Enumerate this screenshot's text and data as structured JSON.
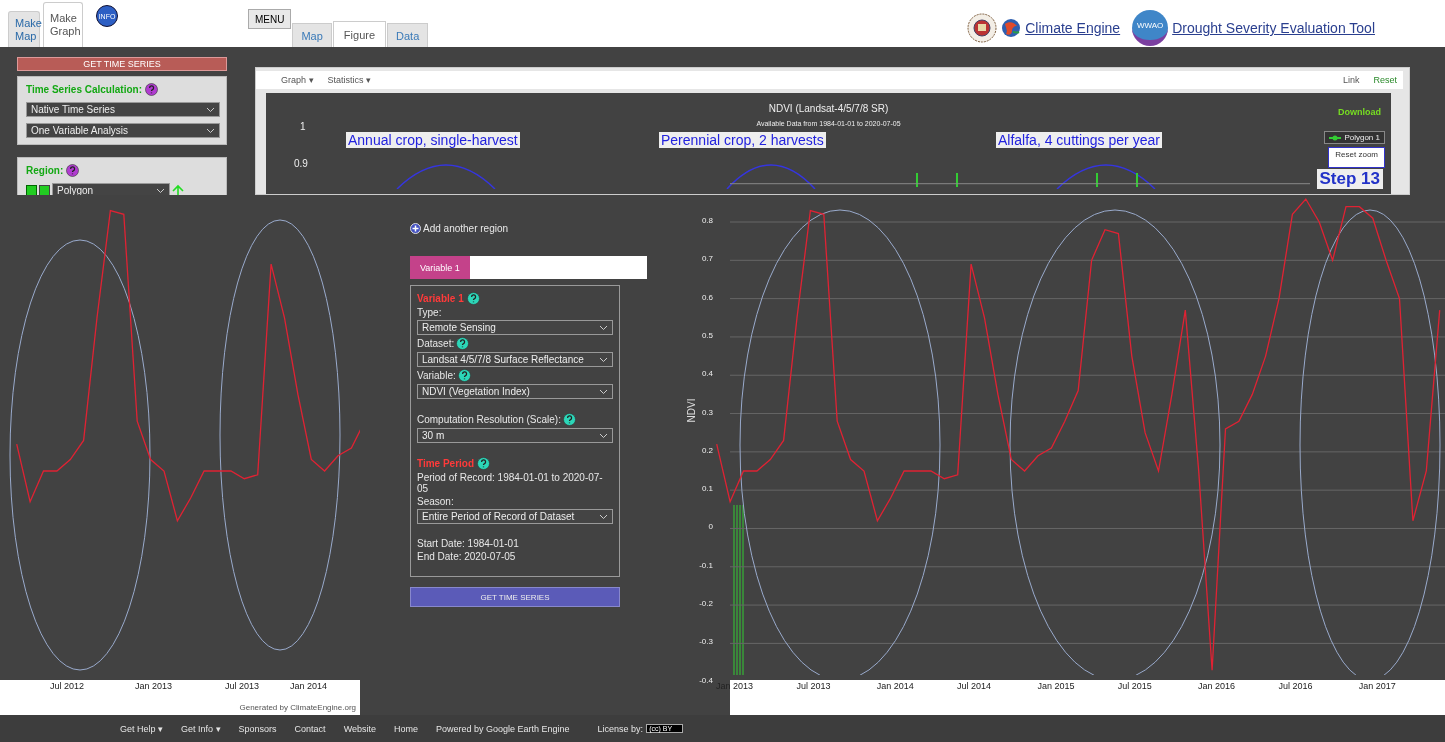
{
  "nav_tabs": [
    {
      "label": "Make Map",
      "selected": false
    },
    {
      "label": "Make Graph",
      "selected": true
    }
  ],
  "info_badge": "INFO",
  "menu_button": "MENU",
  "view_tabs": [
    {
      "label": "Map",
      "selected": false
    },
    {
      "label": "Figure",
      "selected": true
    },
    {
      "label": "Data",
      "selected": false
    }
  ],
  "header": {
    "title": "Climate Engine",
    "badge": "WWAO",
    "subtitle": "Drought Severity Evaluation Tool"
  },
  "sidebar": {
    "button": "GET TIME SERIES",
    "calc_label": "Time Series Calculation:",
    "calc_selects": [
      "Native Time Series",
      "One Variable Analysis"
    ],
    "region_label": "Region:",
    "region_checked": true,
    "region_select": "Polygon"
  },
  "chart_toolbar": {
    "menus": [
      "Graph ▾",
      "Statistics ▾"
    ],
    "links": [
      "Link",
      "Reset"
    ]
  },
  "chart": {
    "title": "NDVI (Landsat-4/5/7/8 SR)",
    "subtitle": "Available Data from 1984-01-01 to 2020-07-05",
    "download": "Download",
    "reset_zoom": "Reset zoom",
    "top_yticks": [
      "1",
      "0.9"
    ],
    "annotations": [
      "Annual crop, single-harvest",
      "Perennial crop, 2 harvests",
      "Alfalfa, 4 cuttings per year"
    ],
    "step": "Step 13",
    "left_xticks": [
      "Jul 2012",
      "Jan 2013",
      "Jul 2013",
      "Jan 2014"
    ],
    "credit": "Generated by ClimateEngine.org",
    "chart_data": {
      "type": "line",
      "ylabel": "NDVI",
      "categories": [
        null,
        "Jan 2013",
        null,
        null,
        null,
        null,
        null,
        "Jul 2013",
        null,
        null,
        null,
        null,
        null,
        "Jan 2014",
        null,
        null,
        null,
        null,
        null,
        "Jul 2014",
        null,
        null,
        null,
        null,
        null,
        "Jan 2015",
        null,
        null,
        null,
        null,
        null,
        "Jul 2015",
        null,
        null,
        null,
        null,
        null,
        "Jan 2016",
        null,
        null,
        null,
        null,
        null,
        "Jul 2016",
        null,
        null,
        null,
        null,
        null,
        "Jan 2017",
        null,
        null,
        null,
        null,
        null
      ],
      "series": [
        {
          "name": "Polygon 1",
          "color": "#e02233",
          "values": [
            0.22,
            0.07,
            0.15,
            0.15,
            0.18,
            0.23,
            0.55,
            0.83,
            0.82,
            0.28,
            0.18,
            0.15,
            0.02,
            0.08,
            0.15,
            0.15,
            0.15,
            0.13,
            0.14,
            0.69,
            0.55,
            0.35,
            0.18,
            0.15,
            0.19,
            0.21,
            0.28,
            0.36,
            0.7,
            0.78,
            0.77,
            0.45,
            0.25,
            0.15,
            0.35,
            0.57,
            0.15,
            -0.37,
            0.26,
            0.28,
            0.35,
            0.45,
            0.6,
            0.82,
            0.86,
            0.8,
            0.7,
            0.84,
            0.84,
            0.81,
            0.7,
            0.6,
            0.02,
            0.15,
            0.57
          ]
        }
      ],
      "ylim": [
        -0.4,
        0.9
      ],
      "grid": true,
      "yticks": [
        0.8,
        0.7,
        0.6,
        0.5,
        0.4,
        0.3,
        0.2,
        0.1,
        0,
        -0.1,
        -0.2,
        -0.3,
        -0.4
      ]
    }
  },
  "variable_panel": {
    "add_region": "Add another region",
    "tab": "Variable 1",
    "heading": "Variable 1",
    "type_label": "Type:",
    "type_value": "Remote Sensing",
    "dataset_label": "Dataset:",
    "dataset_value": "Landsat 4/5/7/8 Surface Reflectance",
    "variable_label": "Variable:",
    "variable_value": "NDVI (Vegetation Index)",
    "scale_label": "Computation Resolution (Scale):",
    "scale_value": "30 m",
    "time_heading": "Time Period",
    "period": "Period of Record: 1984-01-01 to 2020-07-05",
    "season_label": "Season:",
    "season_value": "Entire Period of Record of Dataset",
    "start": "Start Date: 1984-01-01",
    "end": "End Date: 2020-07-05",
    "button": "GET TIME SERIES"
  },
  "footer": {
    "links": [
      "Get Help ▾",
      "Get Info ▾",
      "Sponsors",
      "Contact",
      "Website",
      "Home"
    ],
    "powered": "Powered by Google Earth Engine",
    "license": "License by:",
    "license_badge": "(cc) BY"
  }
}
